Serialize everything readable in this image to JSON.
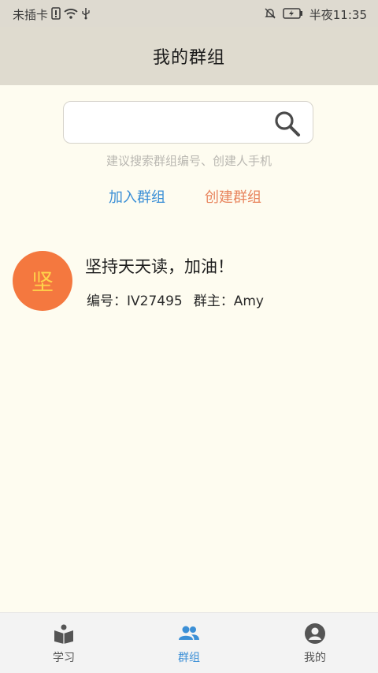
{
  "status_bar": {
    "carrier": "未插卡",
    "time": "半夜11:35"
  },
  "header": {
    "title": "我的群组"
  },
  "search": {
    "value": "",
    "placeholder": "",
    "hint": "建议搜索群组编号、创建人手机"
  },
  "actions": {
    "join_label": "加入群组",
    "create_label": "创建群组"
  },
  "groups": [
    {
      "avatar_char": "坚",
      "name": "坚持天天读，加油！",
      "id_label": "编号：IV27495",
      "owner_label": "群主：Amy"
    }
  ],
  "tabs": [
    {
      "label": "学习",
      "icon": "book-icon"
    },
    {
      "label": "群组",
      "icon": "group-icon"
    },
    {
      "label": "我的",
      "icon": "profile-icon"
    }
  ],
  "colors": {
    "accent": "#3b8fd6",
    "create": "#e8855e",
    "avatar_bg": "#f4783f",
    "background": "#fefcf0"
  }
}
